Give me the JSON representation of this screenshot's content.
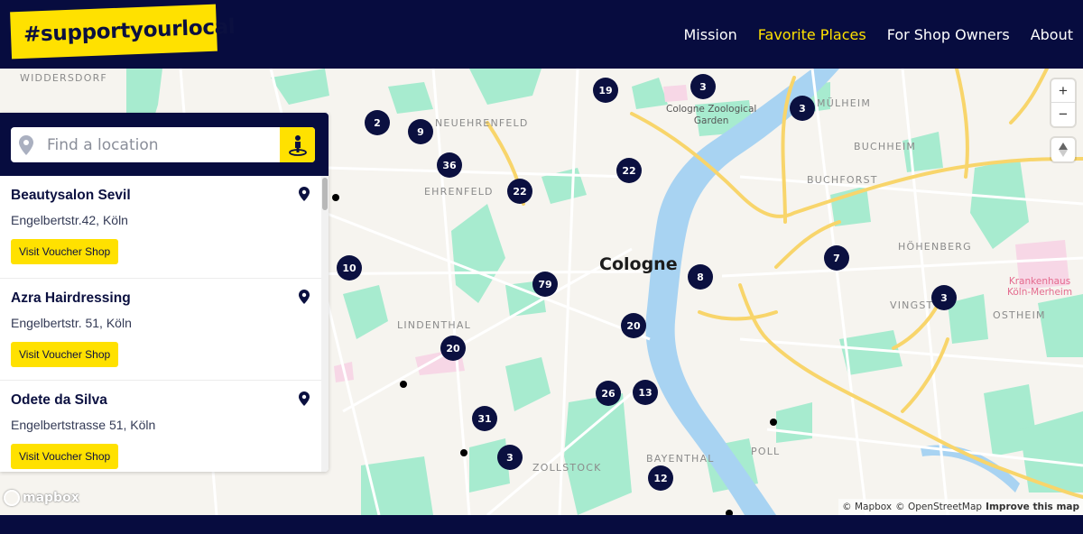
{
  "header": {
    "logo_text": "#supportyourlocal",
    "nav": [
      {
        "label": "Mission",
        "active": false
      },
      {
        "label": "Favorite Places",
        "active": true
      },
      {
        "label": "For Shop Owners",
        "active": false
      },
      {
        "label": "About",
        "active": false
      }
    ]
  },
  "colors": {
    "brand_yellow": "#ffe100",
    "navy": "#070c3f",
    "water": "#a8d3f2",
    "park": "#a7ebcf",
    "road_major": "#f8d56b"
  },
  "search": {
    "placeholder": "Find a location",
    "value": ""
  },
  "shops": [
    {
      "name": "Beautysalon Sevil",
      "address": "Engelbertstr.42, Köln",
      "button": "Visit Voucher Shop"
    },
    {
      "name": "Azra Hairdressing",
      "address": "Engelbertstr. 51, Köln",
      "button": "Visit Voucher Shop"
    },
    {
      "name": "Odete da Silva",
      "address": "Engelbertstrasse 51, Köln",
      "button": "Visit Voucher Shop"
    }
  ],
  "map": {
    "city": "Cologne",
    "districts": [
      "WIDDERSDORF",
      "NEUEHRENFELD",
      "EHRENFELD",
      "LINDENTHAL",
      "ZOLLSTOCK",
      "BAYENTHAL",
      "MÜLHEIM",
      "BUCHHEIM",
      "BUCHFORST",
      "HÖHENBERG",
      "VINGST",
      "OSTHEIM",
      "POLL"
    ],
    "poi": {
      "zoo_line1": "Cologne Zoological",
      "zoo_line2": "Garden",
      "hospital_line1": "Krankenhaus",
      "hospital_line2": "Köln-Merheim"
    },
    "clusters": [
      "19",
      "3",
      "3",
      "2",
      "9",
      "36",
      "22",
      "22",
      "10",
      "79",
      "8",
      "7",
      "3",
      "20",
      "20",
      "26",
      "13",
      "31",
      "3",
      "12"
    ],
    "zoom_in": "+",
    "zoom_out": "−",
    "logo": "mapbox",
    "attribution": {
      "mapbox": "© Mapbox",
      "osm": "© OpenStreetMap",
      "improve": "Improve this map"
    }
  }
}
